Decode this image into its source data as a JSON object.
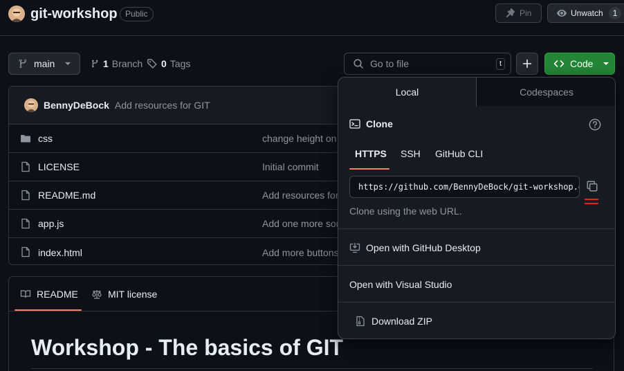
{
  "repo": {
    "name": "git-workshop",
    "visibility": "Public",
    "pin_label": "Pin",
    "unwatch_label": "Unwatch",
    "watch_count": "1"
  },
  "toolbar": {
    "branch": "main",
    "branch_count": "1",
    "branch_label": "Branch",
    "tag_count": "0",
    "tag_label": "Tags",
    "search_placeholder": "Go to file",
    "search_shortcut": "t",
    "code_label": "Code"
  },
  "commit": {
    "author": "BennyDeBock",
    "message": "Add resources for GIT"
  },
  "files": [
    {
      "name": "css",
      "type": "folder",
      "commit": "change height on"
    },
    {
      "name": "LICENSE",
      "type": "file",
      "commit": "Initial commit"
    },
    {
      "name": "README.md",
      "type": "file",
      "commit": "Add resources for"
    },
    {
      "name": "app.js",
      "type": "file",
      "commit": "Add one more sou"
    },
    {
      "name": "index.html",
      "type": "file",
      "commit": "Add more buttons"
    }
  ],
  "readme": {
    "tab_readme": "README",
    "tab_license": "MIT license",
    "heading": "Workshop - The basics of GIT"
  },
  "clone_popover": {
    "tab_local": "Local",
    "tab_codespaces": "Codespaces",
    "title": "Clone",
    "protocols": [
      "HTTPS",
      "SSH",
      "GitHub CLI"
    ],
    "selected_protocol": "HTTPS",
    "url": "https://github.com/BennyDeBock/git-workshop.git",
    "hint": "Clone using the web URL.",
    "open_desktop": "Open with GitHub Desktop",
    "open_vs": "Open with Visual Studio",
    "download_zip": "Download ZIP"
  },
  "colors": {
    "background": "#0d1117",
    "accent_green": "#238636",
    "tab_underline": "#f78166",
    "marker_red": "#e5221e"
  }
}
